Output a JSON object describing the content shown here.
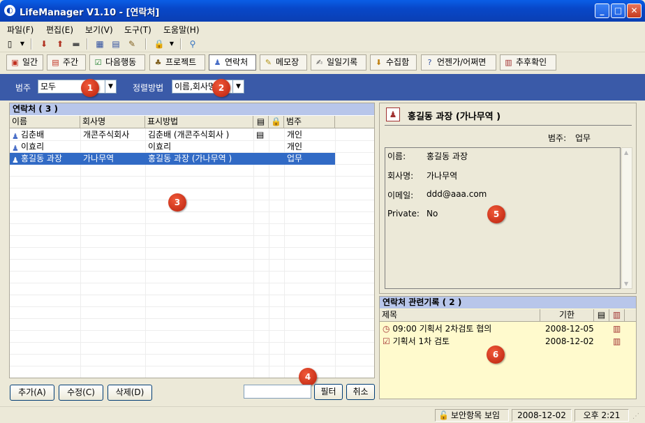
{
  "window": {
    "title": "LifeManager V1.10 - [연락처]"
  },
  "menu": [
    "파일(F)",
    "편집(E)",
    "보기(V)",
    "도구(T)",
    "도움말(H)"
  ],
  "views": [
    {
      "label": "일간",
      "icon": "calendar-day-icon"
    },
    {
      "label": "주간",
      "icon": "calendar-week-icon"
    },
    {
      "label": "다음행동",
      "icon": "checkbox-icon"
    },
    {
      "label": "프로젝트",
      "icon": "hierarchy-icon"
    },
    {
      "label": "연락처",
      "icon": "person-icon",
      "active": true
    },
    {
      "label": "메모장",
      "icon": "notepad-icon"
    },
    {
      "label": "일일기록",
      "icon": "journal-icon"
    },
    {
      "label": "수집함",
      "icon": "inbox-icon"
    },
    {
      "label": "언젠가/어쩌면",
      "icon": "question-icon"
    },
    {
      "label": "추후확인",
      "icon": "followup-icon"
    }
  ],
  "filter": {
    "category_label": "범주",
    "category_value": "모두",
    "sort_label": "정렬방법",
    "sort_value": "이름,회사명"
  },
  "markers": [
    "1",
    "2",
    "3",
    "4",
    "5",
    "6"
  ],
  "contacts": {
    "header": "연락처 ( 3 )",
    "columns": [
      "이름",
      "회사명",
      "표시방법",
      "범주"
    ],
    "rows": [
      {
        "name": "김춘배",
        "company": "개콘주식회사",
        "display": "김춘배 (개콘주식회사 )",
        "category": "개인",
        "has_note": true
      },
      {
        "name": "이효리",
        "company": "",
        "display": "이효리",
        "category": "개인",
        "has_note": false
      },
      {
        "name": "홍길동 과장",
        "company": "가나무역",
        "display": "홍길동 과장 (가나무역 )",
        "category": "업무",
        "has_note": false,
        "selected": true
      }
    ]
  },
  "buttons": {
    "add": "추가(A)",
    "edit": "수정(C)",
    "delete": "삭제(D)",
    "filter": "필터",
    "cancel": "취소"
  },
  "detail": {
    "title": "홍길동 과장 (가나무역 )",
    "category_label": "범주:",
    "category_value": "업무",
    "fields": [
      {
        "label": "이름:",
        "value": "홍길동 과장"
      },
      {
        "label": "회사명:",
        "value": "가나무역"
      },
      {
        "label": "이메일:",
        "value": "ddd@aaa.com"
      },
      {
        "label": "Private:",
        "value": "No"
      }
    ]
  },
  "related": {
    "header": "연락처 관련기록 ( 2 )",
    "columns": [
      "제목",
      "기한"
    ],
    "rows": [
      {
        "title": "09:00 기획서 2차검토 협의",
        "due": "2008-12-05",
        "icon": "appointment-icon"
      },
      {
        "title": "기획서 1차 검토",
        "due": "2008-12-02",
        "icon": "task-icon"
      }
    ]
  },
  "status": {
    "security": "보안항목 보임",
    "date": "2008-12-02",
    "time": "오후 2:21"
  }
}
